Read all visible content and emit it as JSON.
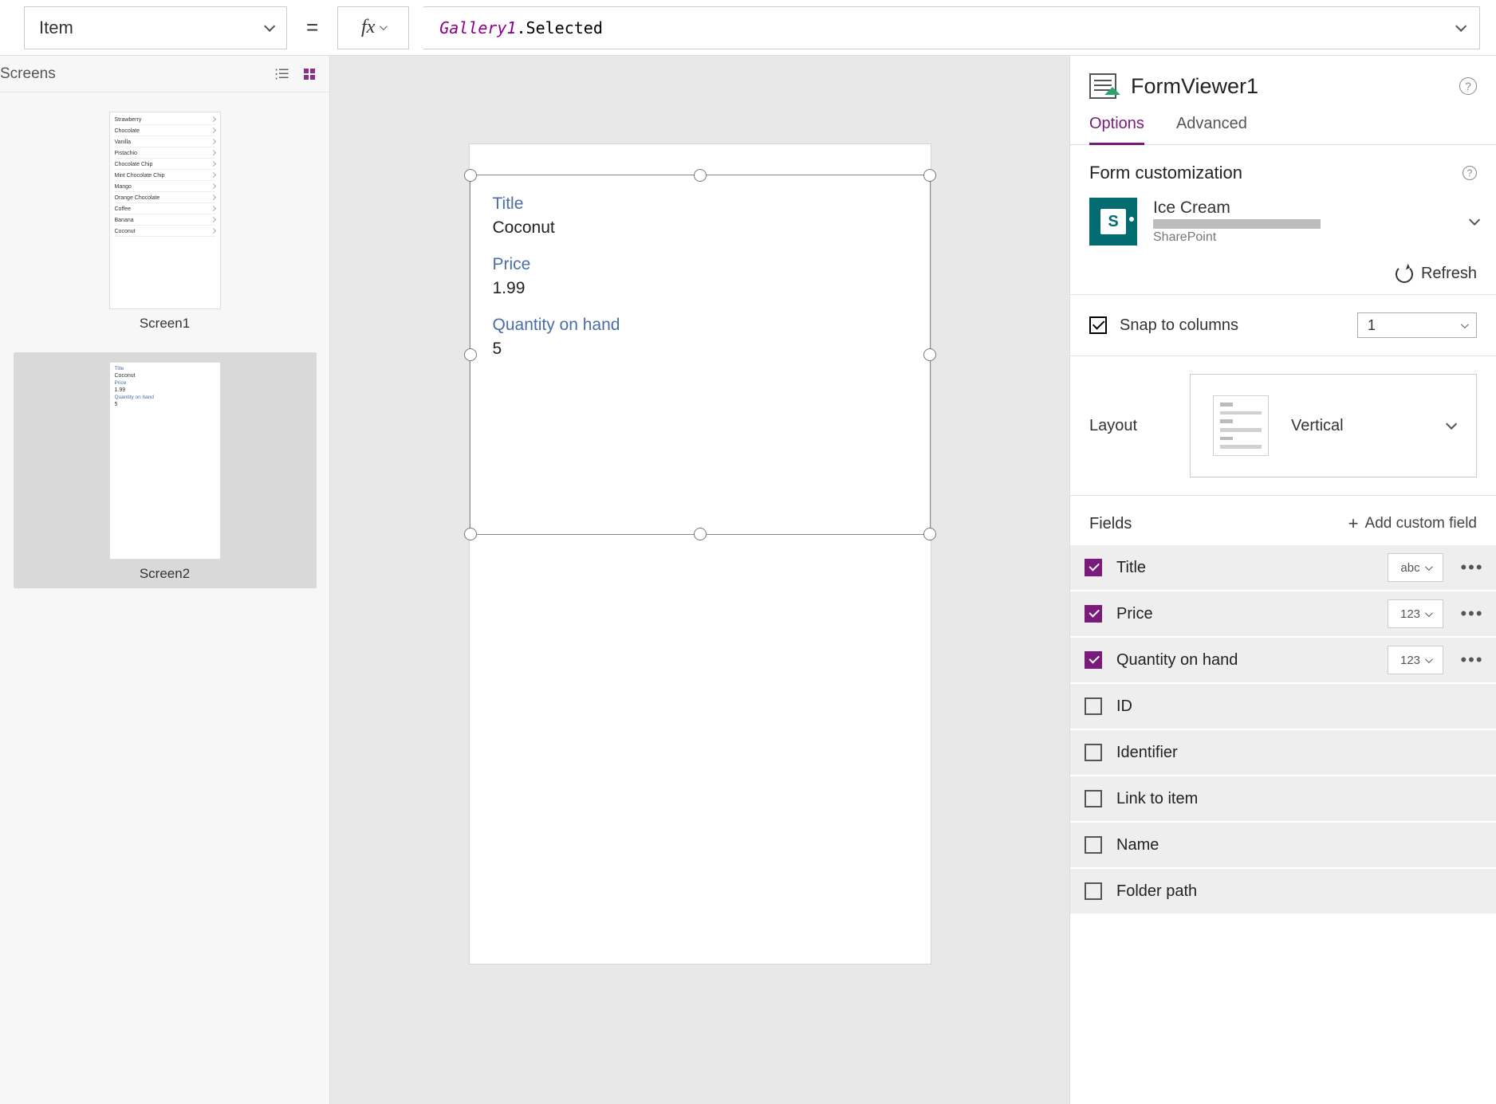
{
  "propDropdown": "Item",
  "formula": {
    "ident": "Gallery1",
    "member": ".Selected"
  },
  "leftPanel": {
    "title": "Screens",
    "screens": [
      {
        "name": "Screen1",
        "items": [
          "Strawberry",
          "Chocolate",
          "Vanilla",
          "Pistachio",
          "Chocolate Chip",
          "Mint Chocolate Chip",
          "Mango",
          "Orange Chocolate",
          "Coffee",
          "Banana",
          "Coconut"
        ]
      },
      {
        "name": "Screen2",
        "form": {
          "Title": "Coconut",
          "Price": "1.99",
          "Quantity on hand": "5"
        }
      }
    ],
    "selected": 1
  },
  "canvasForm": {
    "fields": [
      {
        "label": "Title",
        "value": "Coconut"
      },
      {
        "label": "Price",
        "value": "1.99"
      },
      {
        "label": "Quantity on hand",
        "value": "5"
      }
    ]
  },
  "rightPanel": {
    "controlName": "FormViewer1",
    "tabs": {
      "options": "Options",
      "advanced": "Advanced",
      "active": "options"
    },
    "formCustomization": "Form customization",
    "dataSource": {
      "name": "Ice Cream",
      "connector": "SharePoint"
    },
    "refresh": "Refresh",
    "snapToColumns": {
      "label": "Snap to columns",
      "checked": true,
      "value": "1"
    },
    "layout": {
      "label": "Layout",
      "value": "Vertical"
    },
    "fieldsLabel": "Fields",
    "addCustomField": "Add custom field",
    "fields": [
      {
        "name": "Title",
        "checked": true,
        "type": "abc"
      },
      {
        "name": "Price",
        "checked": true,
        "type": "123"
      },
      {
        "name": "Quantity on hand",
        "checked": true,
        "type": "123"
      },
      {
        "name": "ID",
        "checked": false
      },
      {
        "name": "Identifier",
        "checked": false
      },
      {
        "name": "Link to item",
        "checked": false
      },
      {
        "name": "Name",
        "checked": false
      },
      {
        "name": "Folder path",
        "checked": false
      }
    ]
  }
}
